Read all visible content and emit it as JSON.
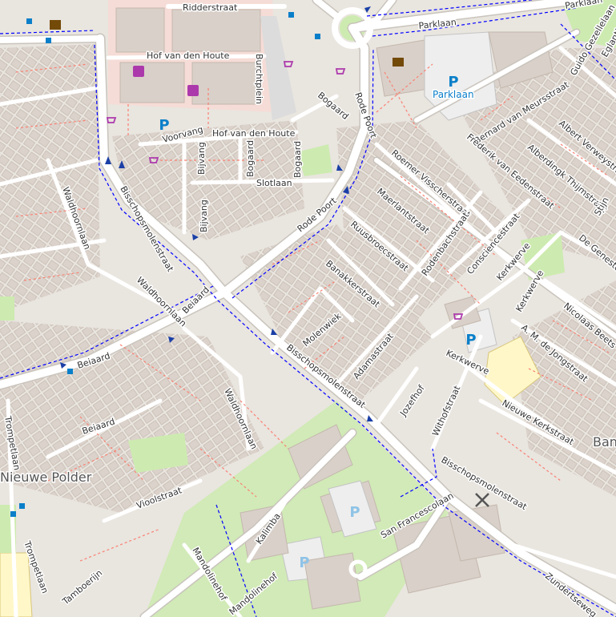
{
  "map": {
    "colors": {
      "land": "#e9e5df",
      "road": "#ffffff",
      "road_casing": "#c9c4bc",
      "building": "#d9d0c9",
      "building_edge": "#c4b8ae",
      "footpath": "#fa8072",
      "cycleway": "#0000ff",
      "grass": "#cdebb0",
      "school": "#fff7c8",
      "parking": "#eeeeee",
      "retail": "#ffd6d1"
    },
    "streets": [
      "Ridderstraat",
      "Parklaan",
      "Parklaan",
      "Hof van den Houte",
      "Burchtplein",
      "Hof van den Houte",
      "Voorvang",
      "Bijvang",
      "Bogaard",
      "Bogaard",
      "Slotlaan",
      "Bogaard",
      "Rode Poort",
      "Rode Poort",
      "Bernard van Meursstraat",
      "Guido Gezellelaan",
      "Eglantier",
      "Albert Verweystraat",
      "Alberdingk Thijmstraat",
      "Roemer Visscherstraat",
      "Frederik van Eedenstraat",
      "Maerlantstraat",
      "Stijn",
      "Ruusbroecstraat",
      "Rodenbachstraat",
      "Consciencestraat",
      "De Genestet",
      "Banakkerstraat",
      "Kerkwerve",
      "Kerkwerve",
      "Nicolaas Beets",
      "Molenwiek",
      "A. M. de Jongstraat",
      "Kerkwerve",
      "Adamastraat",
      "Bisschopsmolenstraat",
      "Bisschopsmolenstraat",
      "Jozefhof",
      "Nieuwe Kerkstraat",
      "Withofstraat",
      "Bisschopsmolenstraat",
      "Waldhoornlaan",
      "Waldhoornlaan",
      "Beiaard",
      "Beiaard",
      "Beiaard",
      "Waldhoornlaan",
      "Trompetlaan",
      "Trompetlaan",
      "Vioolstraat",
      "Kalimba",
      "Mandolinehof",
      "Mandolinehof",
      "Tamboerijn",
      "San Francescolaan",
      "Zundertseweg",
      "Bijvang"
    ],
    "places": [
      "Nieuwe Polder",
      "Ban"
    ],
    "pois": [
      "Parklaan"
    ],
    "parking_symbol": "P",
    "icons": [
      "parking-icon",
      "shop-icon",
      "supermarket-icon",
      "library-icon",
      "bus-stop-icon",
      "windmill-icon",
      "temple-icon",
      "one-way-arrow-icon"
    ]
  }
}
